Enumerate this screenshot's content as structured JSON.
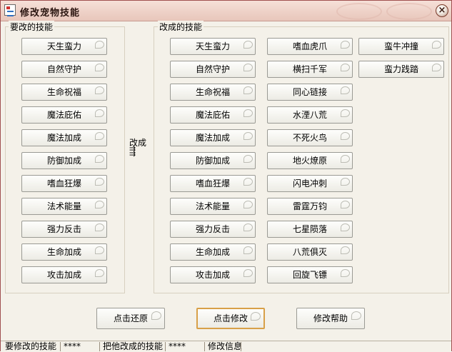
{
  "window": {
    "title": "修改宠物技能",
    "close_label": "×"
  },
  "left_group": {
    "label": "要改的技能",
    "items": [
      "天生蛮力",
      "自然守护",
      "生命祝福",
      "魔法庇佑",
      "魔法加成",
      "防御加成",
      "嗜血狂爆",
      "法术能量",
      "强力反击",
      "生命加成",
      "攻击加成"
    ]
  },
  "arrow": {
    "label": "改成",
    "glyph": "⇉"
  },
  "right_group": {
    "label": "改成的技能",
    "col1": [
      "天生蛮力",
      "自然守护",
      "生命祝福",
      "魔法庇佑",
      "魔法加成",
      "防御加成",
      "嗜血狂爆",
      "法术能量",
      "强力反击",
      "生命加成",
      "攻击加成"
    ],
    "col2": [
      "嗜血虎爪",
      "横扫千军",
      "同心链接",
      "水湮八荒",
      "不死火鸟",
      "地火燎原",
      "闪电冲刺",
      "雷霆万钧",
      "七星陨落",
      "八荒俱灭",
      "回旋飞镖"
    ],
    "col3": [
      "蛮牛冲撞",
      "蛮力践踏"
    ]
  },
  "actions": {
    "restore": "点击还原",
    "modify": "点击修改",
    "help": "修改帮助"
  },
  "status": {
    "from_label": "要修改的技能",
    "from_value": "****",
    "to_label": "把他改成的技能",
    "to_value": "****",
    "info_label": "修改信息"
  }
}
